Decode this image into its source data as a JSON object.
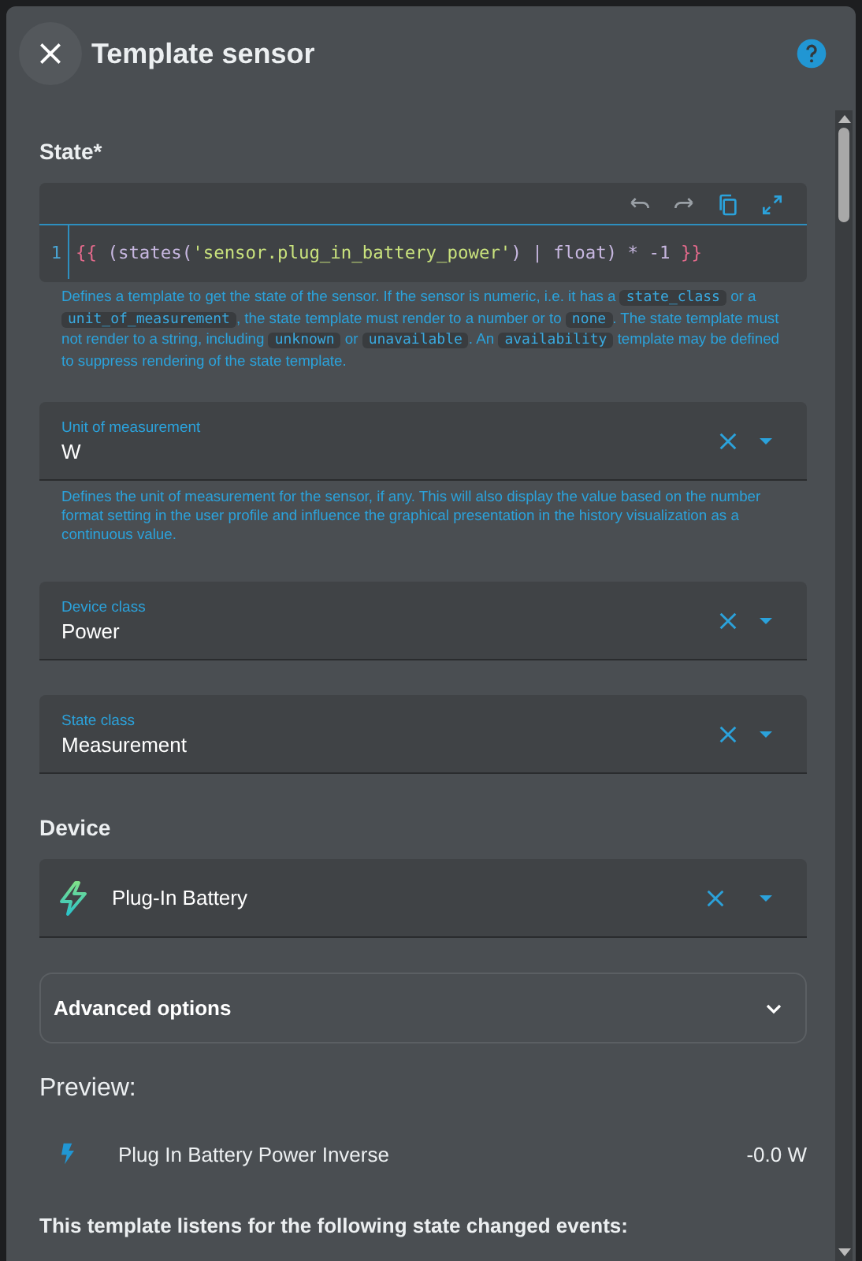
{
  "dialog": {
    "title": "Template sensor"
  },
  "state": {
    "label": "State*",
    "code": {
      "line_number": "1",
      "tokens": [
        {
          "kind": "brace",
          "text": "{{"
        },
        {
          "kind": "plain",
          "text": " (states("
        },
        {
          "kind": "string",
          "text": "'sensor.plug_in_battery_power'"
        },
        {
          "kind": "plain",
          "text": ") | float) * -1 "
        },
        {
          "kind": "brace",
          "text": "}}"
        }
      ]
    },
    "description": [
      {
        "kind": "text",
        "text": "Defines a template to get the state of the sensor. If the sensor is numeric, i.e. it has a "
      },
      {
        "kind": "code",
        "text": "state_class"
      },
      {
        "kind": "text",
        "text": " or a "
      },
      {
        "kind": "code",
        "text": "unit_of_measurement"
      },
      {
        "kind": "text",
        "text": ", the state template must render to a number or to "
      },
      {
        "kind": "code",
        "text": "none"
      },
      {
        "kind": "text",
        "text": ". The state template must not render to a string, including "
      },
      {
        "kind": "code",
        "text": "unknown"
      },
      {
        "kind": "text",
        "text": " or "
      },
      {
        "kind": "code",
        "text": "unavailable"
      },
      {
        "kind": "text",
        "text": ". An "
      },
      {
        "kind": "code",
        "text": "availability"
      },
      {
        "kind": "text",
        "text": " template may be defined to suppress rendering of the state template."
      }
    ]
  },
  "fields": [
    {
      "label": "Unit of measurement",
      "value": "W",
      "helper": "Defines the unit of measurement for the sensor, if any. This will also display the value based on the number format setting in the user profile and influence the graphical presentation in the history visualization as a continuous value."
    },
    {
      "label": "Device class",
      "value": "Power"
    },
    {
      "label": "State class",
      "value": "Measurement"
    }
  ],
  "device": {
    "heading": "Device",
    "value": "Plug-In Battery"
  },
  "advanced": {
    "label": "Advanced options",
    "expanded": false
  },
  "preview": {
    "heading": "Preview:",
    "entity": "Plug In Battery Power Inverse",
    "state": "-0.0 W"
  },
  "listeners": {
    "text": "This template listens for the following state changed events:"
  }
}
